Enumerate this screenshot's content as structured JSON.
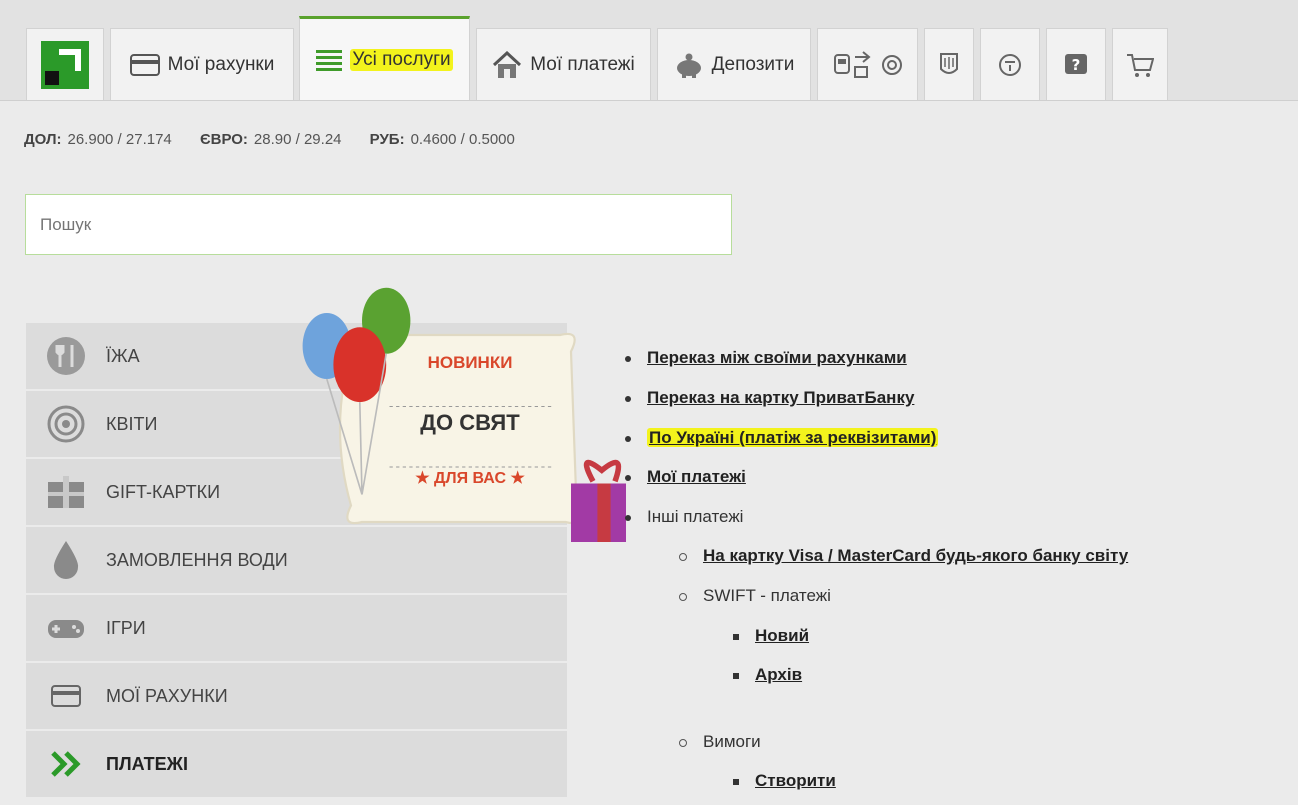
{
  "tabs": {
    "accounts": "Мої рахунки",
    "all_services": "Усі послуги",
    "payments": "Мої платежі",
    "deposits": "Депозити"
  },
  "rates": {
    "usd_label": "ДОЛ:",
    "usd_value": "26.900 / 27.174",
    "eur_label": "ЄВРО:",
    "eur_value": "28.90 / 29.24",
    "rub_label": "РУБ:",
    "rub_value": "0.4600 / 0.5000"
  },
  "search": {
    "placeholder": "Пошук"
  },
  "promo": {
    "line1": "НОВИНКИ",
    "line2": "ДО СВЯТ",
    "line3": "★ ДЛЯ ВАС ★"
  },
  "menu": [
    "ЇЖА",
    "КВІТИ",
    "GIFT-КАРТКИ",
    "ЗАМОВЛЕННЯ ВОДИ",
    "ІГРИ",
    "МОЇ РАХУНКИ",
    "ПЛАТЕЖІ"
  ],
  "links": {
    "own_accounts": "Переказ між своїми рахунками",
    "privat_card": "Переказ на картку ПриватБанку",
    "ukraine": "По Україні (платіж за реквізитами)",
    "my_payments": "Мої платежі",
    "other_payments": "Інші платежі",
    "visa_mc": "На картку Visa / MasterCard будь-якого банку світу",
    "swift": "SWIFT - платежі",
    "new": "Новий",
    "archive": "Архів",
    "requirements": "Вимоги",
    "create": "Створити"
  },
  "colors": {
    "brand_green": "#2b9a29",
    "highlight": "#f3f31c",
    "promo_red": "#d9472b"
  }
}
